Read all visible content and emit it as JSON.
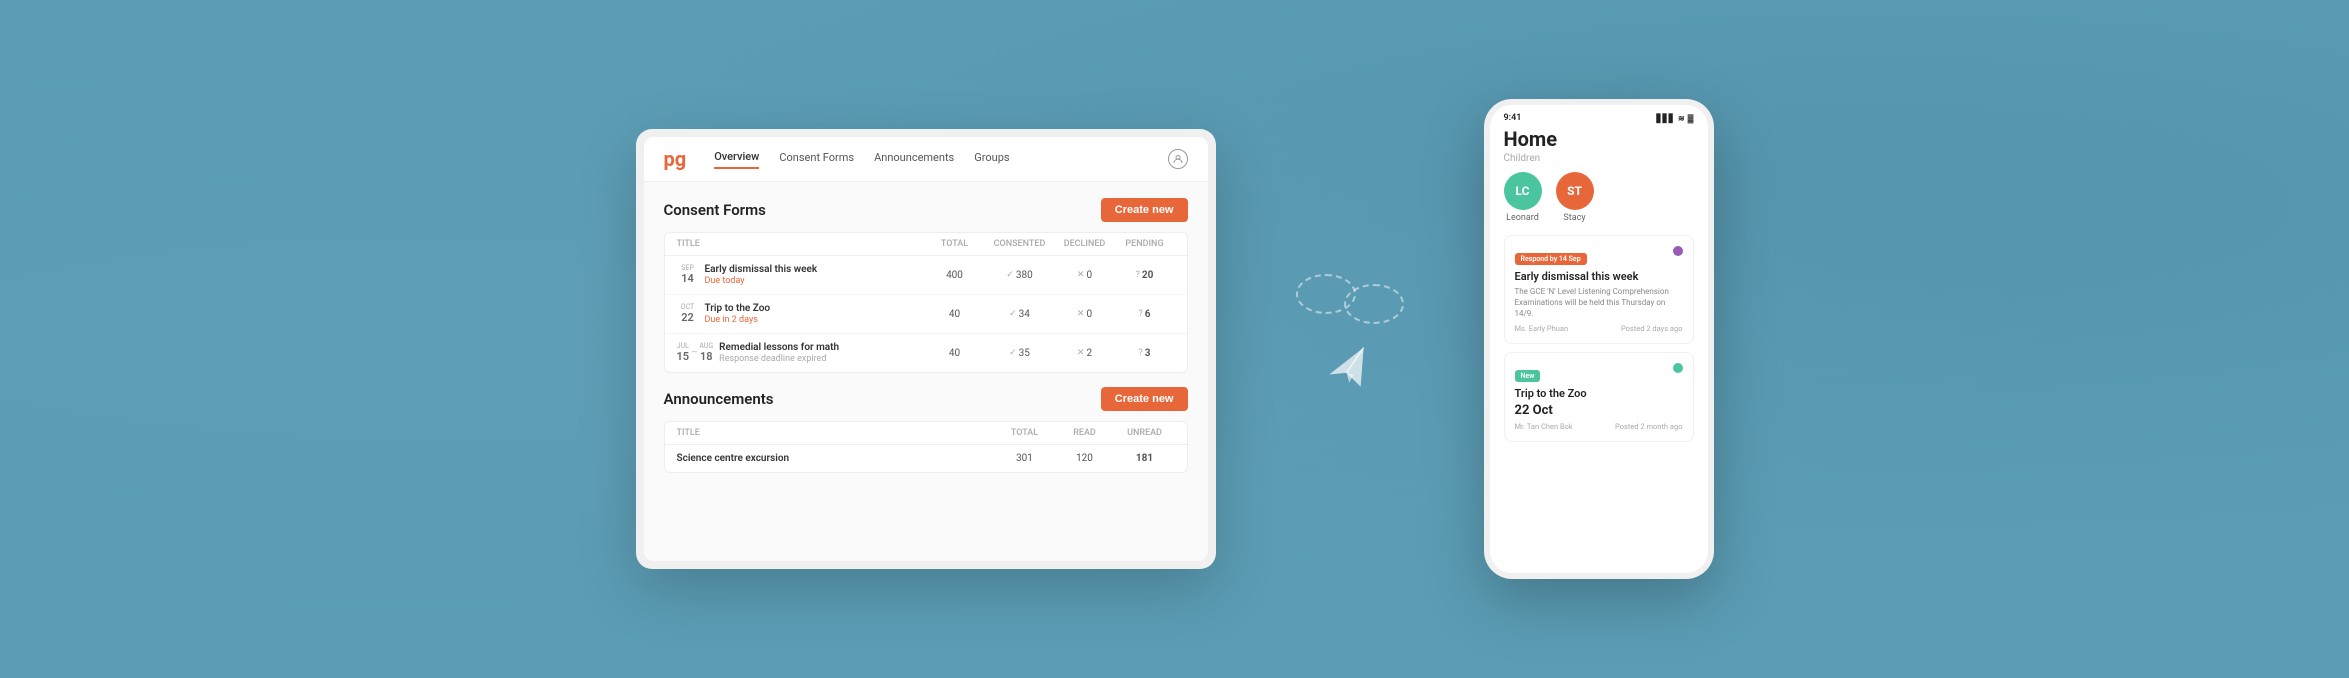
{
  "background": {
    "color": "#5b9db5"
  },
  "laptop": {
    "nav": {
      "logo": "pg",
      "items": [
        "Overview",
        "Consent Forms",
        "Announcements",
        "Groups"
      ],
      "active_item": "Overview"
    },
    "consent_forms": {
      "section_title": "Consent Forms",
      "create_button": "Create new",
      "table_headers": [
        "Title",
        "Total",
        "Consented",
        "Declined",
        "Pending"
      ],
      "rows": [
        {
          "date_month": "Sep",
          "date_day": "14",
          "title": "Early dismissal this week",
          "subtitle": "Due today",
          "subtitle_class": "normal",
          "total": "400",
          "consented": "380",
          "declined": "0",
          "pending": "20"
        },
        {
          "date_month": "Oct",
          "date_day": "22",
          "title": "Trip to the Zoo",
          "subtitle": "Due in 2 days",
          "subtitle_class": "normal",
          "total": "40",
          "consented": "34",
          "declined": "0",
          "pending": "6"
        },
        {
          "date_month_start": "Jul",
          "date_day_start": "15",
          "date_month_end": "Aug",
          "date_day_end": "18",
          "title": "Remedial lessons for math",
          "subtitle": "Response deadline expired",
          "subtitle_class": "expired",
          "total": "40",
          "consented": "35",
          "declined": "2",
          "pending": "3"
        }
      ]
    },
    "announcements": {
      "section_title": "Announcements",
      "create_button": "Create new",
      "table_headers": [
        "Title",
        "Total",
        "Read",
        "Unread"
      ],
      "rows": [
        {
          "title": "Science centre excursion",
          "total": "301",
          "read": "120",
          "unread": "181"
        }
      ]
    }
  },
  "arrow_area": {
    "decoration": "paper plane arrow"
  },
  "phone": {
    "status_bar": {
      "time": "9:41",
      "icons": "signal wifi battery"
    },
    "home_title": "Home",
    "children_label": "Children",
    "children": [
      {
        "initials": "LC",
        "name": "Leonard",
        "color_class": "avatar-lc"
      },
      {
        "initials": "ST",
        "name": "Stacy",
        "color_class": "avatar-st"
      }
    ],
    "cards": [
      {
        "badge": "Respond by 14 Sep",
        "badge_class": "badge-respond",
        "dot_class": "dot-purple",
        "title": "Early dismissal this week",
        "description": "The GCE 'N' Level Listening Comprehension Examinations will be held this Thursday on 14/9.",
        "author": "Ms. Early Phuan",
        "posted": "Posted 2 days ago"
      },
      {
        "badge": "New",
        "badge_class": "badge-new",
        "dot_class": "dot-teal",
        "title": "Trip to the Zoo",
        "date": "22 Oct",
        "author": "Mr. Tan Chen Bok",
        "posted": "Posted 2 month ago"
      }
    ]
  }
}
